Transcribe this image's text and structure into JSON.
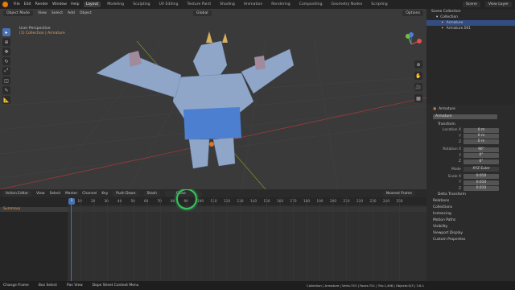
{
  "topbar": {
    "menus": [
      "File",
      "Edit",
      "Render",
      "Window",
      "Help"
    ],
    "workspaces": [
      "Layout",
      "Modeling",
      "Sculpting",
      "UV Editing",
      "Texture Paint",
      "Shading",
      "Animation",
      "Rendering",
      "Compositing",
      "Geometry Nodes",
      "Scripting"
    ],
    "active_workspace": "Layout",
    "scene_label": "Scene",
    "view_layer_label": "View Layer"
  },
  "viewport": {
    "mode": "Object Mode",
    "menus": [
      "View",
      "Select",
      "Add",
      "Object"
    ],
    "orientation": "Global",
    "options_label": "Options",
    "overlay_title": "User Perspective",
    "overlay_sub": "(1) Collection | Armature",
    "gizmo_axes": [
      "X",
      "Y",
      "Z"
    ]
  },
  "outliner": {
    "rows": [
      {
        "label": "Scene Collection",
        "indent": 0,
        "selected": false
      },
      {
        "label": "Collection",
        "indent": 1,
        "selected": false
      },
      {
        "label": "Armature",
        "indent": 2,
        "selected": true
      },
      {
        "label": "Armature.001",
        "indent": 2,
        "selected": false
      }
    ]
  },
  "properties": {
    "object_name": "Armature",
    "data_name": "Armature",
    "transform_header": "Transform",
    "location": {
      "label": "Location X",
      "y": "Y",
      "z": "Z",
      "values": [
        "0 m",
        "0 m",
        "0 m"
      ]
    },
    "rotation": {
      "label": "Rotation X",
      "y": "Y",
      "z": "Z",
      "values": [
        "90°",
        "0°",
        "0°"
      ]
    },
    "mode_label": "Mode",
    "mode_value": "XYZ Euler",
    "scale": {
      "label": "Scale X",
      "y": "Y",
      "z": "Z",
      "values": [
        "0.010",
        "0.010",
        "0.010"
      ]
    },
    "sections": [
      "Delta Transform",
      "Relations",
      "Collections",
      "Instancing",
      "Motion Paths",
      "Visibility",
      "Viewport Display",
      "Custom Properties"
    ]
  },
  "dopesheet": {
    "editor": "Action Editor",
    "menus": [
      "View",
      "Select",
      "Marker",
      "Channel",
      "Key"
    ],
    "push_down": "Push Down",
    "stash": "Stash",
    "action_name": "Close",
    "frame_mode": "Nearest Frame",
    "current_frame": "1",
    "ticks": [
      "10",
      "20",
      "30",
      "40",
      "50",
      "60",
      "70",
      "80",
      "90",
      "100",
      "110",
      "120",
      "130",
      "140",
      "150",
      "160",
      "170",
      "180",
      "190",
      "200",
      "210",
      "220",
      "230",
      "240",
      "250"
    ],
    "channel": "Summary"
  },
  "statusbar": {
    "items": [
      "Change Frame",
      "Box Select",
      "Pan View",
      "Dope Sheet Context Menu"
    ],
    "stats": "Collection | Armature | Verts:753 | Faces:751 | Tris:1,498 | Objects:0/3 | 3.6.1"
  }
}
